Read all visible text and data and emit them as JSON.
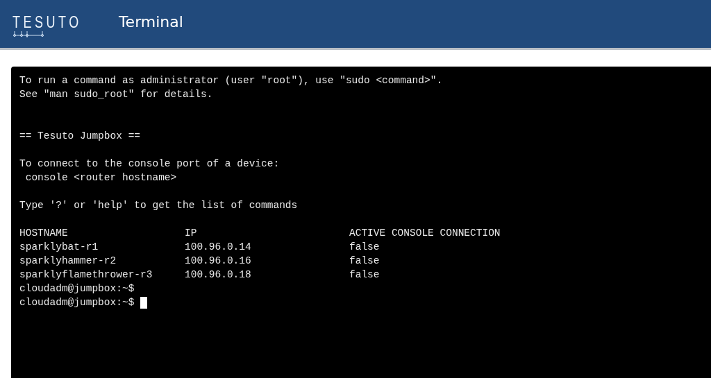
{
  "header": {
    "logo": "TESUTO",
    "title": "Terminal"
  },
  "terminal": {
    "lines": [
      {
        "kind": "text",
        "text": "To run a command as administrator (user \"root\"), use \"sudo <command>\"."
      },
      {
        "kind": "text",
        "text": "See \"man sudo_root\" for details."
      },
      {
        "kind": "blank"
      },
      {
        "kind": "blank"
      },
      {
        "kind": "text",
        "text": "== Tesuto Jumpbox =="
      },
      {
        "kind": "blank"
      },
      {
        "kind": "text",
        "text": "To connect to the console port of a device:"
      },
      {
        "kind": "text",
        "text": " console <router hostname>"
      },
      {
        "kind": "blank"
      },
      {
        "kind": "text",
        "text": "Type '?' or 'help' to get the list of commands"
      },
      {
        "kind": "blank"
      }
    ],
    "table": {
      "columns": [
        "HOSTNAME",
        "IP",
        "ACTIVE CONSOLE CONNECTION"
      ],
      "rows": [
        [
          "sparklybat-r1",
          "100.96.0.14",
          "false"
        ],
        [
          "sparklyhammer-r2",
          "100.96.0.16",
          "false"
        ],
        [
          "sparklyflamethrower-r3",
          "100.96.0.18",
          "false"
        ]
      ]
    },
    "prompts": [
      {
        "text": "cloudadm@jumpbox:~$",
        "cursor": false
      },
      {
        "text": "cloudadm@jumpbox:~$",
        "cursor": true
      }
    ]
  }
}
